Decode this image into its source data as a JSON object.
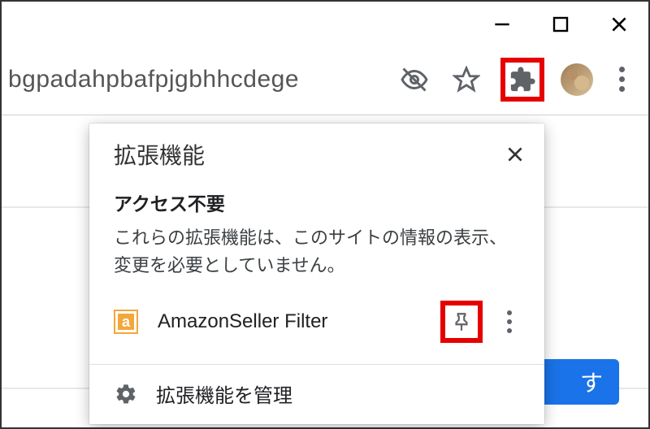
{
  "window": {
    "minimize": "–",
    "maximize": "◻",
    "close": "✕"
  },
  "toolbar": {
    "address_fragment": "bgpadahpbafpjgbhhcdege"
  },
  "popup": {
    "title": "拡張機能",
    "close": "✕",
    "section_title": "アクセス不要",
    "section_desc": "これらの拡張機能は、このサイトの情報の表示、変更を必要としていません。",
    "items": [
      {
        "icon_letter": "a",
        "name": "AmazonSeller Filter"
      }
    ],
    "footer": {
      "label": "拡張機能を管理"
    }
  },
  "background": {
    "button_visible_text": "す"
  }
}
